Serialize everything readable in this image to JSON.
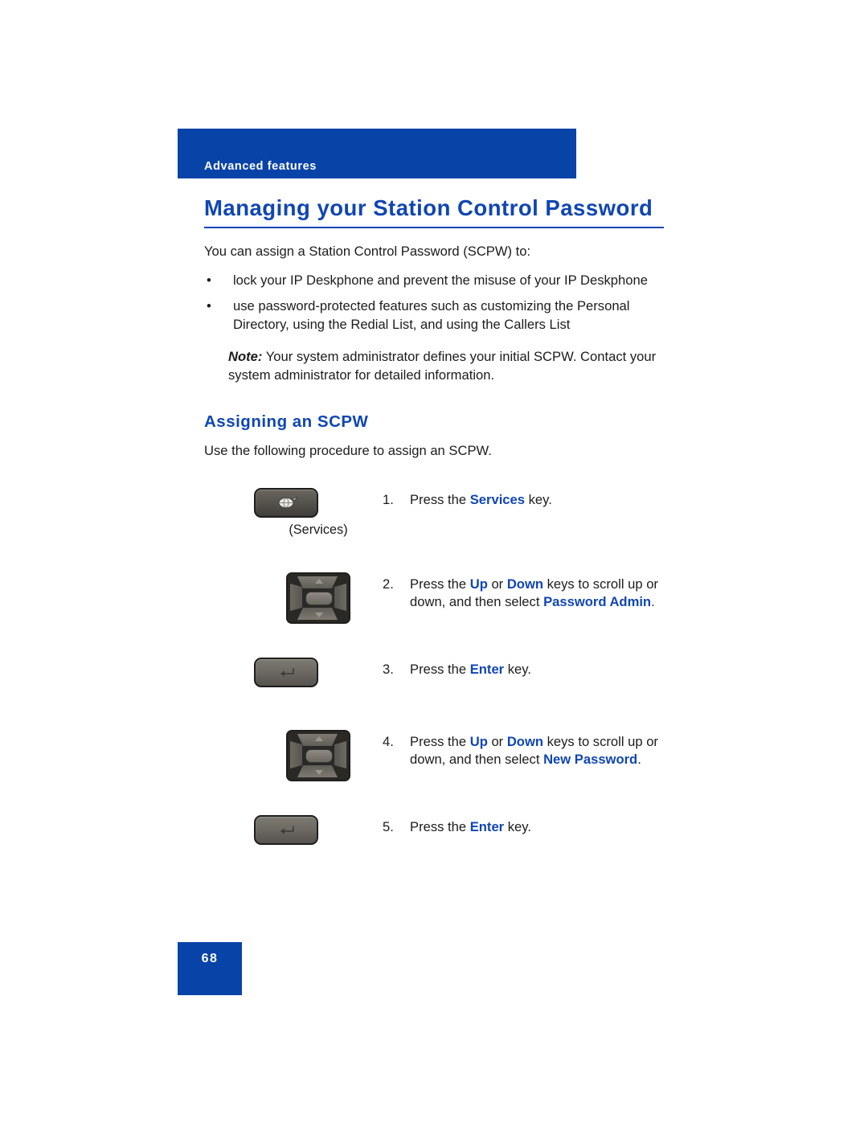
{
  "header": {
    "running_head": "Advanced features"
  },
  "title": {
    "text": "Managing your Station Control Password",
    "color": "#1046B4"
  },
  "intro": {
    "lead": "You can assign a Station Control Password (SCPW) to:",
    "bullets": [
      "lock your IP Deskphone and prevent the misuse of your IP Deskphone",
      "use password-protected features such as customizing the Personal Directory, using the Redial List, and using the Callers List"
    ],
    "note_label": "Note:",
    "note_text": " Your system administrator defines your initial SCPW. Contact your system administrator for detailed information."
  },
  "section": {
    "heading": "Assigning an SCPW",
    "intro": "Use the following procedure to assign an SCPW."
  },
  "steps": [
    {
      "number": "1.",
      "icon": "services-key-icon",
      "caption": "(Services)",
      "parts": [
        {
          "text": "Press the ",
          "kw": false
        },
        {
          "text": "Services",
          "kw": true
        },
        {
          "text": " key.",
          "kw": false
        }
      ]
    },
    {
      "number": "2.",
      "icon": "navigation-cluster-key-icon",
      "caption": "",
      "parts": [
        {
          "text": "Press the ",
          "kw": false
        },
        {
          "text": "Up",
          "kw": true
        },
        {
          "text": " or ",
          "kw": false
        },
        {
          "text": "Down",
          "kw": true
        },
        {
          "text": " keys to scroll up or down, and then select ",
          "kw": false
        },
        {
          "text": "Password Admin",
          "kw": true
        },
        {
          "text": ".",
          "kw": false
        }
      ]
    },
    {
      "number": "3.",
      "icon": "enter-key-icon",
      "caption": "",
      "parts": [
        {
          "text": "Press the ",
          "kw": false
        },
        {
          "text": "Enter",
          "kw": true
        },
        {
          "text": " key.",
          "kw": false
        }
      ]
    },
    {
      "number": "4.",
      "icon": "navigation-cluster-key-icon",
      "caption": "",
      "parts": [
        {
          "text": "Press the ",
          "kw": false
        },
        {
          "text": "Up",
          "kw": true
        },
        {
          "text": " or ",
          "kw": false
        },
        {
          "text": "Down",
          "kw": true
        },
        {
          "text": " keys to scroll up or down, and then select ",
          "kw": false
        },
        {
          "text": "New Password",
          "kw": true
        },
        {
          "text": ".",
          "kw": false
        }
      ]
    },
    {
      "number": "5.",
      "icon": "enter-key-icon",
      "caption": "",
      "parts": [
        {
          "text": "Press the ",
          "kw": false
        },
        {
          "text": "Enter",
          "kw": true
        },
        {
          "text": " key.",
          "kw": false
        }
      ]
    }
  ],
  "footer": {
    "page_number": "68",
    "color": "#0843A8"
  }
}
